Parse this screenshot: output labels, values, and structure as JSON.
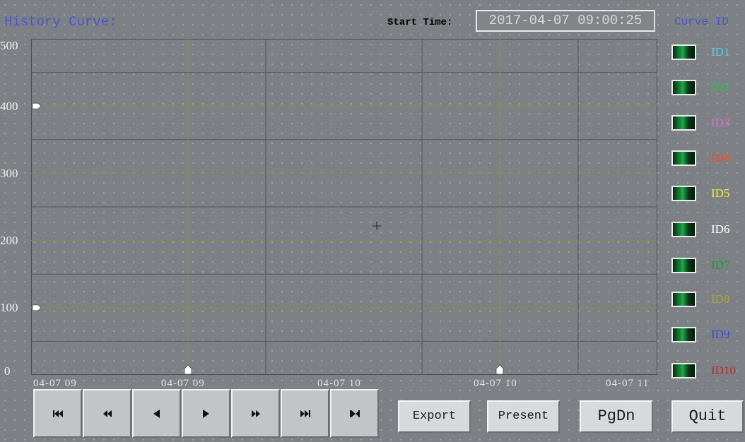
{
  "header": {
    "title": "History Curve:",
    "start_time_label": "Start Time:",
    "start_time_value": "2017-04-07 09:00:25",
    "curve_id_title": "Curve ID"
  },
  "chart_data": {
    "type": "line",
    "y_ticks": [
      "500",
      "400",
      "300",
      "200",
      "100",
      "0"
    ],
    "x_ticks": [
      "04-07 09",
      "04-07 09",
      "04-07 10",
      "04-07 10",
      "04-07 11"
    ],
    "ylim": [
      0,
      500
    ],
    "grid": true,
    "series": []
  },
  "legend": [
    {
      "label": "ID1",
      "color": "#5ec9e6"
    },
    {
      "label": "ID2",
      "color": "#2ebd4a"
    },
    {
      "label": "ID3",
      "color": "#d774c6"
    },
    {
      "label": "ID4",
      "color": "#ff4a1e"
    },
    {
      "label": "ID5",
      "color": "#f4ec3a"
    },
    {
      "label": "ID6",
      "color": "#ffffff"
    },
    {
      "label": "ID7",
      "color": "#1e9a3e"
    },
    {
      "label": "ID8",
      "color": "#a8a43c"
    },
    {
      "label": "ID9",
      "color": "#3a4cd0"
    },
    {
      "label": "ID10",
      "color": "#b42828"
    }
  ],
  "nav_buttons": [
    {
      "icon": "first-icon"
    },
    {
      "icon": "fast-rewind-icon"
    },
    {
      "icon": "step-back-icon"
    },
    {
      "icon": "step-forward-icon"
    },
    {
      "icon": "fast-forward-icon"
    },
    {
      "icon": "last-icon"
    },
    {
      "icon": "skip-end-icon"
    }
  ],
  "actions": {
    "export": "Export",
    "present": "Present",
    "pgdn": "PgDn",
    "quit": "Quit"
  }
}
